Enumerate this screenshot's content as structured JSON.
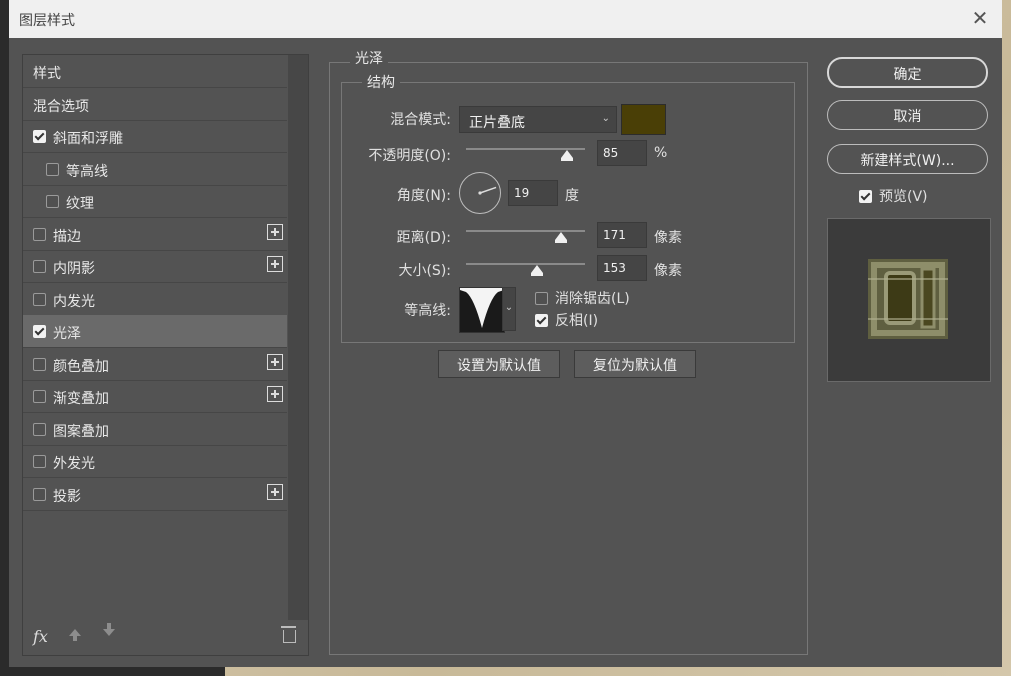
{
  "window": {
    "title": "图层样式"
  },
  "styles_list": {
    "items": [
      {
        "label": "样式",
        "checkbox": false,
        "indent": false,
        "plus": false,
        "selected": false
      },
      {
        "label": "混合选项",
        "checkbox": false,
        "indent": false,
        "plus": false,
        "selected": false
      },
      {
        "label": "斜面和浮雕",
        "checkbox": true,
        "checked": true,
        "indent": false,
        "plus": false,
        "selected": false
      },
      {
        "label": "等高线",
        "checkbox": true,
        "checked": false,
        "indent": true,
        "plus": false,
        "selected": false
      },
      {
        "label": "纹理",
        "checkbox": true,
        "checked": false,
        "indent": true,
        "plus": false,
        "selected": false
      },
      {
        "label": "描边",
        "checkbox": true,
        "checked": false,
        "indent": false,
        "plus": true,
        "selected": false
      },
      {
        "label": "内阴影",
        "checkbox": true,
        "checked": false,
        "indent": false,
        "plus": true,
        "selected": false
      },
      {
        "label": "内发光",
        "checkbox": true,
        "checked": false,
        "indent": false,
        "plus": false,
        "selected": false
      },
      {
        "label": "光泽",
        "checkbox": true,
        "checked": true,
        "indent": false,
        "plus": false,
        "selected": true
      },
      {
        "label": "颜色叠加",
        "checkbox": true,
        "checked": false,
        "indent": false,
        "plus": true,
        "selected": false
      },
      {
        "label": "渐变叠加",
        "checkbox": true,
        "checked": false,
        "indent": false,
        "plus": true,
        "selected": false
      },
      {
        "label": "图案叠加",
        "checkbox": true,
        "checked": false,
        "indent": false,
        "plus": false,
        "selected": false
      },
      {
        "label": "外发光",
        "checkbox": true,
        "checked": false,
        "indent": false,
        "plus": false,
        "selected": false
      },
      {
        "label": "投影",
        "checkbox": true,
        "checked": false,
        "indent": false,
        "plus": true,
        "selected": false
      }
    ],
    "footer": {
      "fx_label": "fx"
    }
  },
  "satin": {
    "group_title": "光泽",
    "structure_title": "结构",
    "blend_mode": {
      "label": "混合模式:",
      "value": "正片叠底",
      "color": "#4a3f06"
    },
    "opacity": {
      "label": "不透明度(O):",
      "value": "85",
      "unit": "%",
      "fraction": 0.85
    },
    "angle": {
      "label": "角度(N):",
      "value": "19",
      "unit": "度",
      "degrees": 19
    },
    "distance": {
      "label": "距离(D):",
      "value": "171",
      "unit": "像素",
      "fraction": 0.8
    },
    "size": {
      "label": "大小(S):",
      "value": "153",
      "unit": "像素",
      "fraction": 0.6
    },
    "contour": {
      "label": "等高线:",
      "anti_alias": {
        "label": "消除锯齿(L)",
        "checked": false
      },
      "invert": {
        "label": "反相(I)",
        "checked": true
      }
    },
    "set_default": "设置为默认值",
    "reset_default": "复位为默认值"
  },
  "actions": {
    "ok": "确定",
    "cancel": "取消",
    "new_style": "新建样式(W)...",
    "preview": {
      "label": "预览(V)",
      "checked": true
    }
  }
}
